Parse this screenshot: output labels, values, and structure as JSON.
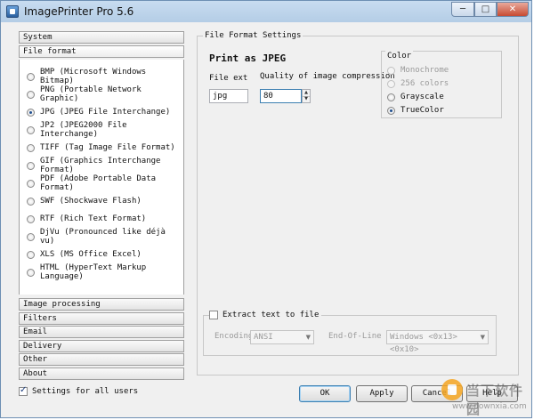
{
  "window": {
    "title": "ImagePrinter Pro 5.6",
    "min_glyph": "─",
    "max_glyph": "□",
    "close_glyph": "✕"
  },
  "nav": {
    "system": "System",
    "file_format": "File format",
    "image_processing": "Image processing",
    "filters": "Filters",
    "email": "Email",
    "delivery": "Delivery",
    "other": "Other",
    "about": "About"
  },
  "formats": [
    {
      "label": "BMP  (Microsoft Windows Bitmap)",
      "selected": false
    },
    {
      "label": "PNG  (Portable Network Graphic)",
      "selected": false
    },
    {
      "label": "JPG  (JPEG File Interchange)",
      "selected": true
    },
    {
      "label": "JP2  (JPEG2000 File Interchange)",
      "selected": false
    },
    {
      "label": "TIFF  (Tag Image File Format)",
      "selected": false
    },
    {
      "label": "GIF  (Graphics Interchange Format)",
      "selected": false
    },
    {
      "label": "PDF  (Adobe Portable Data Format)",
      "selected": false
    },
    {
      "label": "SWF  (Shockwave Flash)",
      "selected": false
    },
    {
      "label": "RTF  (Rich Text Format)",
      "selected": false
    },
    {
      "label": "DjVu  (Pronounced like déjà vu)",
      "selected": false
    },
    {
      "label": "XLS   (MS Office  Excel)",
      "selected": false
    },
    {
      "label": "HTML  (HyperText Markup Language)",
      "selected": false
    }
  ],
  "settings_for_all": {
    "label": "Settings for all users",
    "checked": true
  },
  "panel": {
    "group_title": "File Format Settings",
    "print_title": "Print as JPEG",
    "file_ext_label": "File ext",
    "file_ext_value": "jpg",
    "quality_label": "Quality of image compression",
    "quality_value": "80"
  },
  "color": {
    "title": "Color",
    "options": [
      {
        "label": "Monochrome",
        "enabled": false,
        "selected": false
      },
      {
        "label": "256 colors",
        "enabled": false,
        "selected": false
      },
      {
        "label": "Grayscale",
        "enabled": true,
        "selected": false
      },
      {
        "label": "TrueColor",
        "enabled": true,
        "selected": true
      }
    ]
  },
  "extract": {
    "label": "Extract text to file",
    "checked": false,
    "encoding_label": "Encoding",
    "encoding_value": "ANSI",
    "eol_label": "End-Of-Line",
    "eol_value": "Windows <0x13> <0x10>"
  },
  "buttons": {
    "ok": "OK",
    "apply": "Apply",
    "cancel": "Cancel",
    "help": "Help"
  },
  "watermark": {
    "text": "当下软件园",
    "url": "www.downxia.com"
  }
}
